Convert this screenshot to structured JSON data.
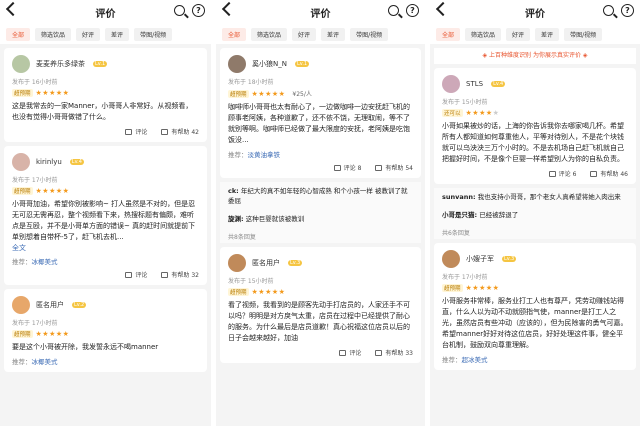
{
  "header": {
    "title": "评价"
  },
  "tabs": [
    "全部",
    "筛选饮品",
    "好评",
    "差评",
    "带图/视频"
  ],
  "actions": {
    "comment": "评论",
    "helpful": "有帮助"
  },
  "panel1": {
    "cards": [
      {
        "name": "麦麦养乐多绿茶",
        "level": "Lv.1",
        "date": "发布于 16小时前",
        "rating_label": "超预期",
        "body": "这是我常去的一家Manner，小哥哥人非常好。从视频看，也没有觉得小哥哥做错了什么。",
        "helpful": "42"
      },
      {
        "name": "kirinlyu",
        "level": "Lv.4",
        "date": "发布于 17小时前",
        "rating_label": "超预期",
        "body": "小哥哥加油，希望你别被影响~ 打人虽然是不对的，但是忍无可忍无需再忍，整个视频看下来，热搜标题有偏颇，难听点是互殴，并不是小哥单方面的错误~ 真的赶时间就提前下单别想着自带杯-5了，赶飞机去机...",
        "fulltext": "全文",
        "rec_label": "推荐：",
        "rec_value": "冰椰美式",
        "helpful": "32"
      },
      {
        "name": "匿名用户",
        "level": "Lv.2",
        "date": "发布于 17小时前",
        "rating_label": "超预期",
        "body": "要是这个小哥被开除，我发誓永远不喝manner",
        "rec_label": "推荐：",
        "rec_value": "冰椰美式"
      }
    ]
  },
  "panel2": {
    "cards": [
      {
        "name": "奚小狼N_N",
        "level": "Lv.1",
        "date": "发布于 18小时前",
        "rating_label": "超预期",
        "price": "¥25/人",
        "body": "咖啡师小哥哥也太有耐心了，一边做咖啡一边安抚赶飞机的顾事老阿姨，各种道歉了，还不依不饶，无理取闹，等不了就别等啊。咖啡师已经做了最大限度的安抚，老阿姨是吃饱饭没...",
        "rec_label": "推荐：",
        "rec_value": "淡黄油拿铁",
        "comments": "8",
        "helpful": "54"
      }
    ],
    "replies": [
      {
        "user": "ck:",
        "text": "年纪大的真不如年轻的心智成熟 和个小孩一样 被教训了就委屈"
      },
      {
        "user": "旋渊:",
        "text": "这种巨婴就该被教训"
      }
    ],
    "more": "共8条回复",
    "cards2": [
      {
        "name": "匿名用户",
        "level": "Lv.3",
        "date": "发布于 15小时前",
        "rating_label": "超预期",
        "body": "看了视频，我看到的是顾客先动手打店员的，人家还手不可以吗？明明是对方戾气太重，店员在过程中已经提供了耐心的服务。为什么最后是店员道歉！真心祝福这位店员以后的日子会越来越好，加油",
        "helpful": "33"
      }
    ]
  },
  "panel3": {
    "banner": "上百种维度识别 为你展示真实评价",
    "cards": [
      {
        "name": "STLS",
        "level": "Lv.4",
        "date": "发布于 15小时前",
        "rating_label": "还可以",
        "body": "小哥如果被炒的话，上海的你告诉我你去哪家喝几杯。希望所有人都知道如何尊重他人，平等对待别人，不是花个块钱就可以乌泱泱三万个小时的。不是去机场自己赶飞机就自己把握好时间，不是像个巨婴一样希望别人为你的自私负责。",
        "comments": "6",
        "helpful": "46"
      }
    ],
    "replies": [
      {
        "user": "sunvann:",
        "text": "我也支持小哥哥，那个老女人真希望将她入肉出来"
      },
      {
        "user": "小哥是只猫:",
        "text": "已经被辞退了"
      }
    ],
    "more": "共6条回复",
    "cards2": [
      {
        "name": "小嫂子军",
        "level": "Lv.3",
        "date": "发布于 17小时前",
        "rating_label": "超预期",
        "body": "小哥服务非常棒，服务业打工人也有尊严，凭劳动赚钱站得直，什么人以为动不动就颐指气使，manner是打工人之光，虽然店员有些冲动（应该的），但为民除害的勇气可嘉。希望manner好好对待这位店员，好好处理这件事，健全平台机制，鼓励双向尊重理解。",
        "rec_label": "推荐：",
        "rec_value": "超冰美式"
      }
    ]
  }
}
